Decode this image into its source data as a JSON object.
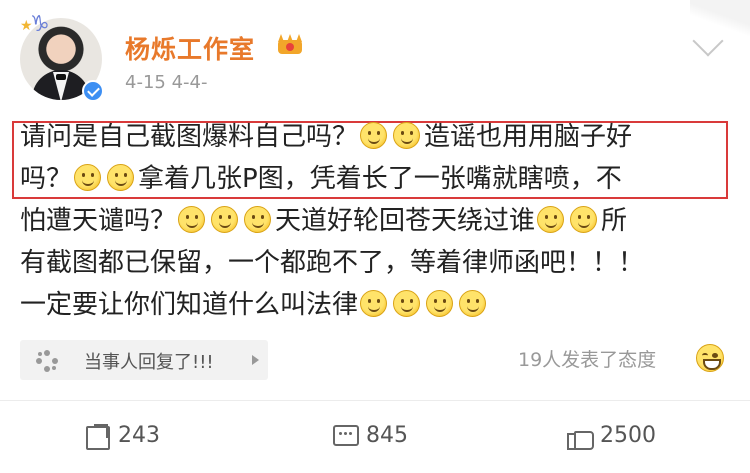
{
  "header": {
    "author_name": "杨烁工作室",
    "timestamp": "4-15",
    "timestamp_extra": "4-4-",
    "avatar_badge_icon": "verified-icon",
    "vip_icon": "crown-icon",
    "menu_icon": "chevron-down-icon"
  },
  "post": {
    "lines": [
      {
        "segments": [
          "请问是自己截图爆料自己吗？",
          ":emoji:",
          ":emoji:",
          "造谣也用用脑子好"
        ]
      },
      {
        "segments": [
          "吗？",
          ":emoji:",
          ":emoji:",
          "拿着几张P图，凭着长了一张嘴就瞎喷，不"
        ]
      },
      {
        "segments": [
          "怕遭天谴吗？",
          ":emoji:",
          ":emoji:",
          ":emoji:",
          "天道好轮回苍天绕过谁",
          ":emoji:",
          ":emoji:",
          "所"
        ]
      },
      {
        "segments": [
          "有截图都已保留，一个都跑不了，等着律师函吧！！！"
        ]
      },
      {
        "segments": [
          "一定要让你们知道什么叫法律",
          ":emoji:",
          ":emoji:",
          ":emoji:",
          ":emoji:"
        ]
      }
    ],
    "emoji_icon": "smile-emoji-icon",
    "highlight_color": "#d93a3a"
  },
  "topic": {
    "label": "当事人回复了!!!",
    "icon": "topic-icon"
  },
  "attitude": {
    "label": "19人发表了态度",
    "icon": "grin-emoji-icon"
  },
  "actions": {
    "share_count": "243",
    "comment_count": "845",
    "like_count": "2500"
  },
  "colors": {
    "author": "#e8792b",
    "meta": "#999999",
    "text": "#222222"
  }
}
